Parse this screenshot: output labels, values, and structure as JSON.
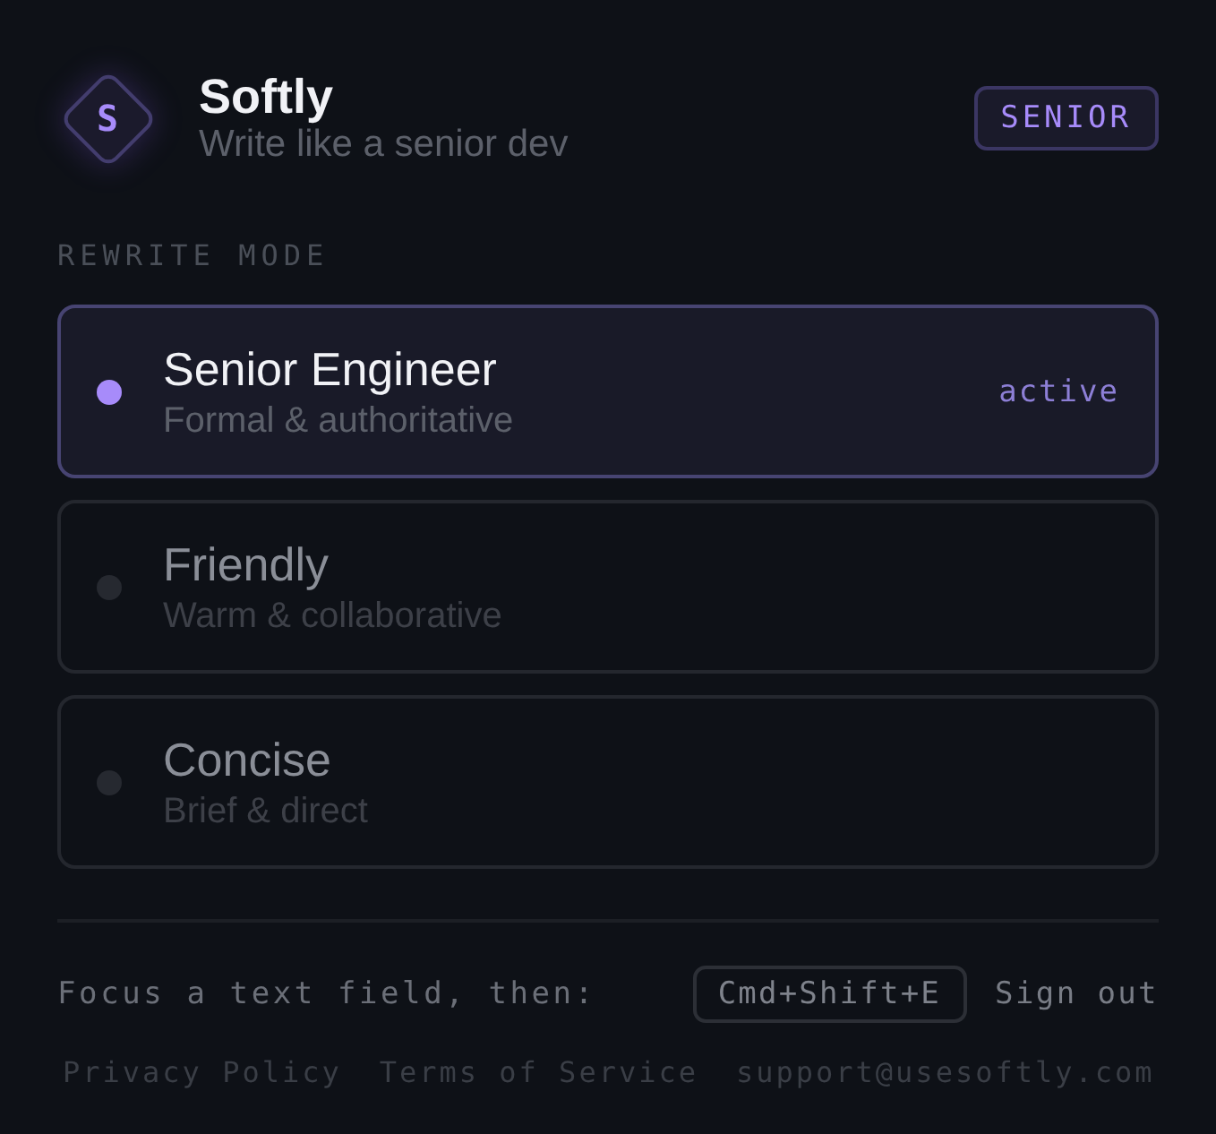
{
  "app": {
    "logo_letter": "S",
    "name": "Softly",
    "tagline": "Write like a senior dev",
    "tier_badge": "SENIOR"
  },
  "section_label": "REWRITE MODE",
  "modes": [
    {
      "title": "Senior Engineer",
      "description": "Formal & authoritative",
      "selected": true,
      "status": "active"
    },
    {
      "title": "Friendly",
      "description": "Warm & collaborative",
      "selected": false
    },
    {
      "title": "Concise",
      "description": "Brief & direct",
      "selected": false
    }
  ],
  "footer": {
    "hint": "Focus a text field, then:",
    "shortcut": "Cmd+Shift+E",
    "sign_out": "Sign out",
    "links": [
      "Privacy Policy",
      "Terms of Service",
      "support@usesoftly.com"
    ]
  }
}
